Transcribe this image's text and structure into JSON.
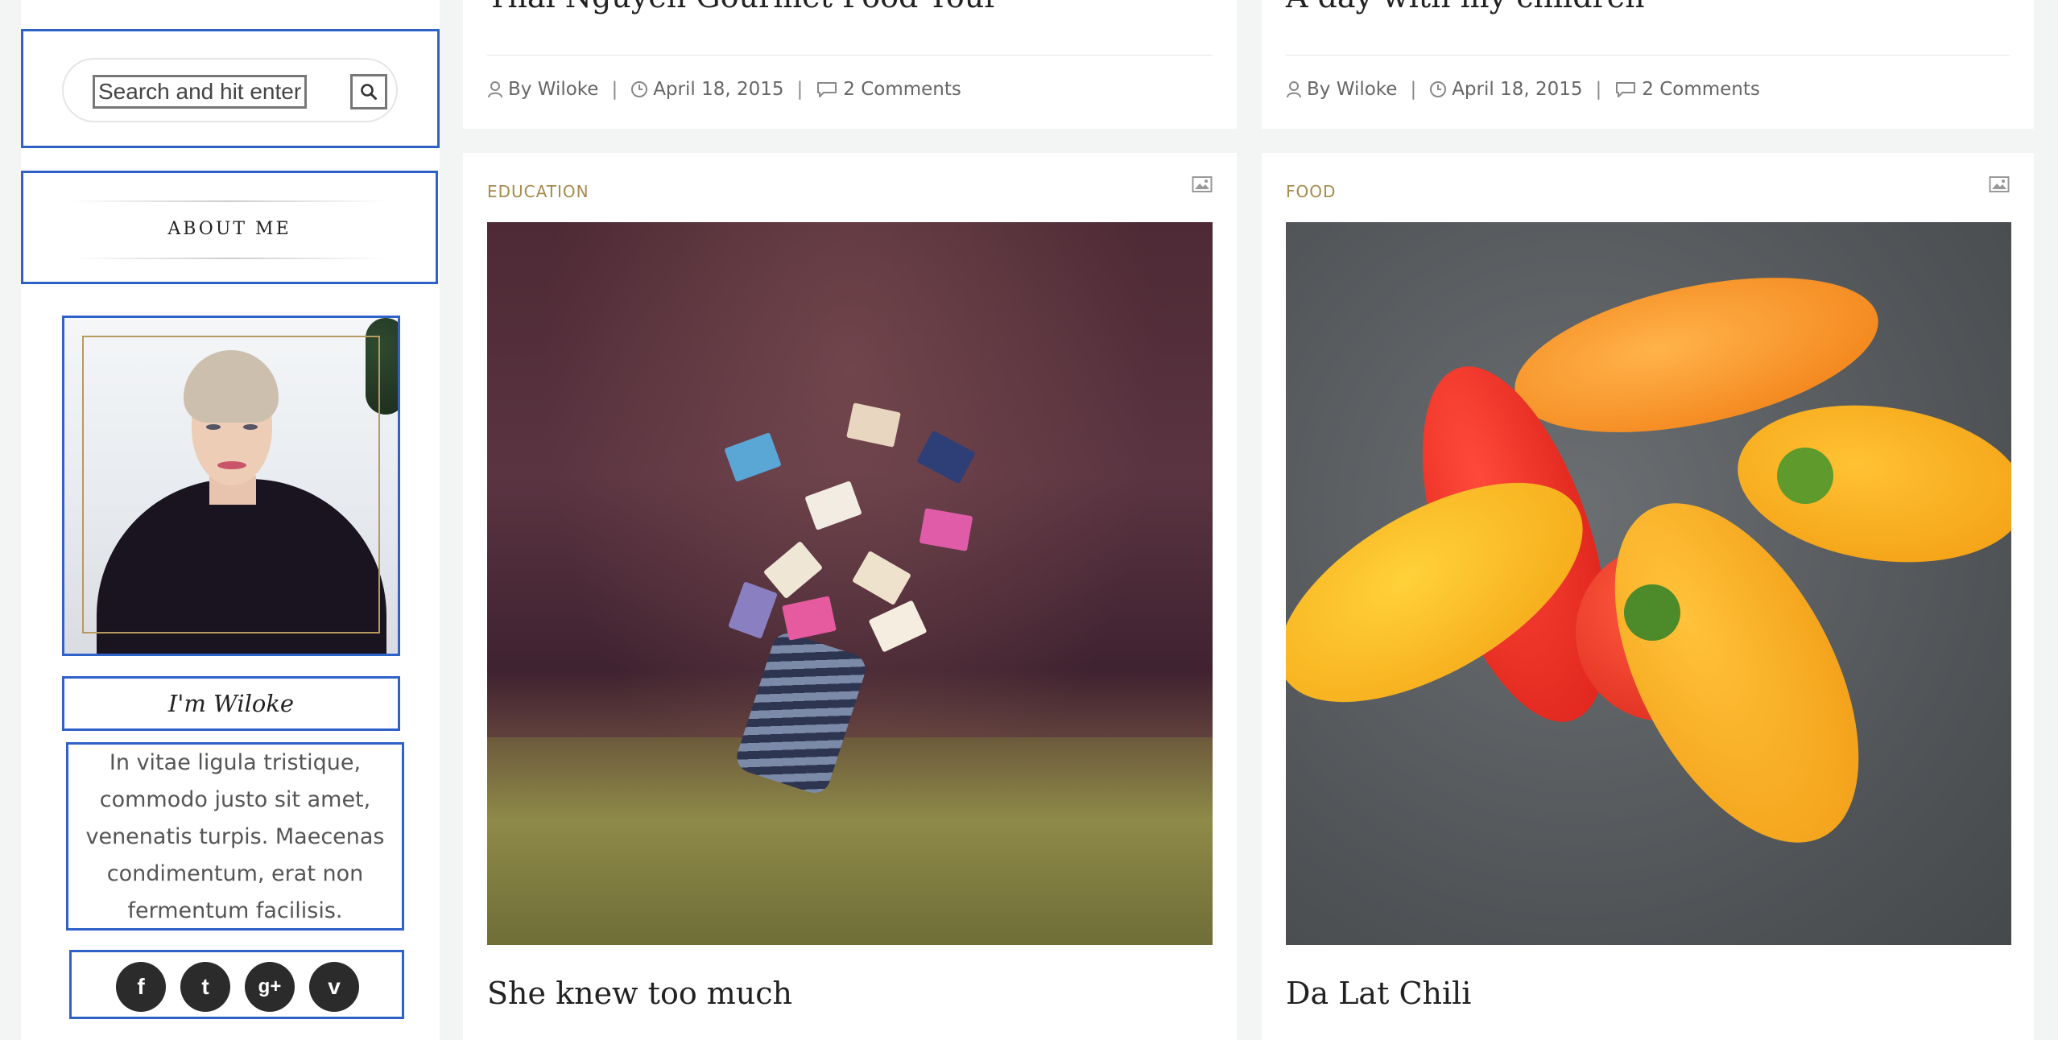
{
  "sidebar": {
    "search": {
      "placeholder": "Search and hit enter"
    },
    "about": {
      "title": "ABOUT ME"
    },
    "profile": {
      "name": "I'm Wiloke",
      "bio": "In vitae ligula tristique, commodo justo sit amet, venenatis turpis. Maecenas condimentum, erat non fermentum facilisis."
    },
    "social": [
      {
        "icon": "facebook-icon",
        "glyph": "f"
      },
      {
        "icon": "twitter-icon",
        "glyph": "t"
      },
      {
        "icon": "google-plus-icon",
        "glyph": "g+"
      },
      {
        "icon": "vimeo-icon",
        "glyph": "v"
      }
    ]
  },
  "posts": {
    "top_left": {
      "title": "Thai Nguyen Gourmet Food Tour",
      "author": "By Wiloke",
      "date": "April 18, 2015",
      "comments": "2 Comments"
    },
    "top_right": {
      "title": "A day with my children",
      "author": "By Wiloke",
      "date": "April 18, 2015",
      "comments": "2 Comments"
    },
    "main_left": {
      "category": "EDUCATION",
      "title": "She knew too much"
    },
    "main_right": {
      "category": "FOOD",
      "title": "Da Lat Chili"
    }
  },
  "colors": {
    "highlight_border": "#2f62c9",
    "category": "#a68a4c",
    "background": "#f3f4f4"
  }
}
